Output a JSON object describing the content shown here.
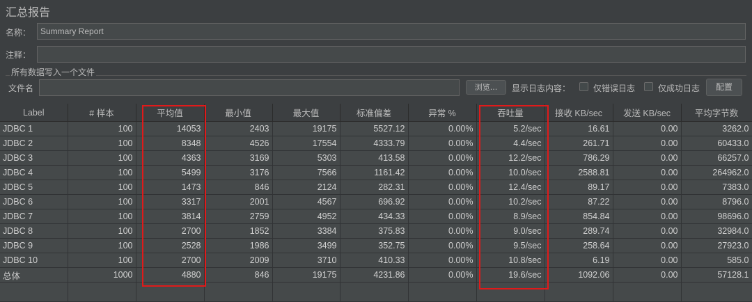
{
  "window": {
    "title": "汇总报告"
  },
  "name_field": {
    "label": "名称：",
    "value": "Summary Report"
  },
  "comment_field": {
    "label": "注释：",
    "value": ""
  },
  "file_group": {
    "title": "所有数据写入一个文件",
    "filename_label": "文件名",
    "filename_value": "",
    "browse_label": "浏览...",
    "log_label": "显示日志内容：",
    "errors_only_label": "仅错误日志",
    "success_only_label": "仅成功日志",
    "configure_label": "配置"
  },
  "table": {
    "headers": [
      "Label",
      "# 样本",
      "平均值",
      "最小值",
      "最大值",
      "标准偏差",
      "异常 %",
      "吞吐量",
      "接收 KB/sec",
      "发送 KB/sec",
      "平均字节数"
    ],
    "rows": [
      [
        "JDBC 1",
        "100",
        "14053",
        "2403",
        "19175",
        "5527.12",
        "0.00%",
        "5.2/sec",
        "16.61",
        "0.00",
        "3262.0"
      ],
      [
        "JDBC 2",
        "100",
        "8348",
        "4526",
        "17554",
        "4333.79",
        "0.00%",
        "4.4/sec",
        "261.71",
        "0.00",
        "60433.0"
      ],
      [
        "JDBC 3",
        "100",
        "4363",
        "3169",
        "5303",
        "413.58",
        "0.00%",
        "12.2/sec",
        "786.29",
        "0.00",
        "66257.0"
      ],
      [
        "JDBC 4",
        "100",
        "5499",
        "3176",
        "7566",
        "1161.42",
        "0.00%",
        "10.0/sec",
        "2588.81",
        "0.00",
        "264962.0"
      ],
      [
        "JDBC 5",
        "100",
        "1473",
        "846",
        "2124",
        "282.31",
        "0.00%",
        "12.4/sec",
        "89.17",
        "0.00",
        "7383.0"
      ],
      [
        "JDBC 6",
        "100",
        "3317",
        "2001",
        "4567",
        "696.92",
        "0.00%",
        "10.2/sec",
        "87.22",
        "0.00",
        "8796.0"
      ],
      [
        "JDBC 7",
        "100",
        "3814",
        "2759",
        "4952",
        "434.33",
        "0.00%",
        "8.9/sec",
        "854.84",
        "0.00",
        "98696.0"
      ],
      [
        "JDBC 8",
        "100",
        "2700",
        "1852",
        "3384",
        "375.83",
        "0.00%",
        "9.0/sec",
        "289.74",
        "0.00",
        "32984.0"
      ],
      [
        "JDBC 9",
        "100",
        "2528",
        "1986",
        "3499",
        "352.75",
        "0.00%",
        "9.5/sec",
        "258.64",
        "0.00",
        "27923.0"
      ],
      [
        "JDBC 10",
        "100",
        "2700",
        "2009",
        "3710",
        "410.33",
        "0.00%",
        "10.8/sec",
        "6.19",
        "0.00",
        "585.0"
      ],
      [
        "总体",
        "1000",
        "4880",
        "846",
        "19175",
        "4231.86",
        "0.00%",
        "19.6/sec",
        "1092.06",
        "0.00",
        "57128.1"
      ]
    ]
  },
  "colors": {
    "background": "#3c3f41",
    "highlight": "#e01a1a"
  }
}
